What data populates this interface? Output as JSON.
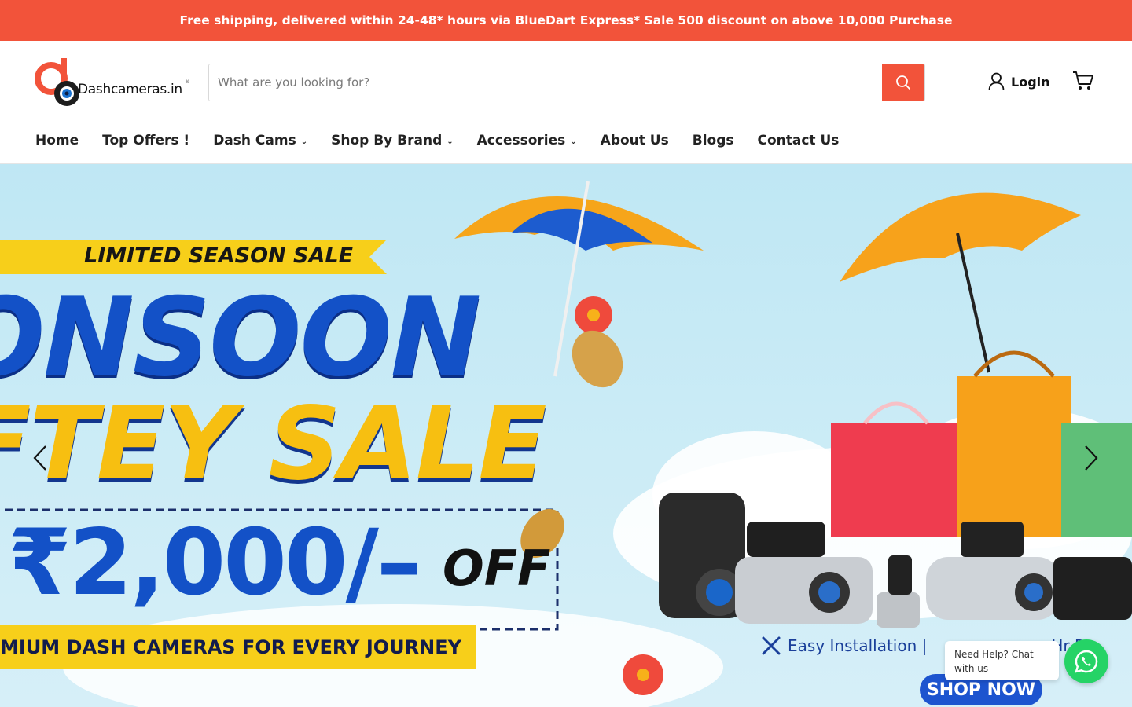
{
  "announcement": "Free shipping, delivered within 24-48* hours via BlueDart Express* Sale 500 discount on above 10,000 Purchase",
  "brand": {
    "logo_text": "Dashcameras.in",
    "registered": "®"
  },
  "search": {
    "placeholder": "What are you looking for?",
    "value": ""
  },
  "header": {
    "login_label": "Login"
  },
  "nav": {
    "items": [
      {
        "label": "Home"
      },
      {
        "label": "Top Offers !"
      },
      {
        "label": "Dash Cams"
      },
      {
        "label": "Shop By Brand"
      },
      {
        "label": "Accessories"
      },
      {
        "label": "About Us"
      },
      {
        "label": "Blogs"
      },
      {
        "label": "Contact Us"
      }
    ]
  },
  "hero": {
    "badge": "LIMITED SEASON SALE",
    "headline_1": "ONSOON",
    "headline_2": "FTEY SALE",
    "amount": "₹2,000/–",
    "off": "OFF",
    "tagline": "MIUM DASH CAMERAS FOR EVERY JOURNEY",
    "feature_1": "Easy Installation |",
    "feature_2": "Hr P",
    "cta": "SHOP NOW"
  },
  "chat": {
    "bubble_text": "Need Help? Chat with us"
  },
  "colors": {
    "accent": "#f2533a",
    "hero_blue": "#1351c7",
    "hero_yellow": "#f7bf11",
    "whatsapp": "#25d366"
  },
  "icons": [
    "search-icon",
    "user-icon",
    "cart-icon",
    "chevron-left-icon",
    "chevron-right-icon",
    "whatsapp-icon"
  ]
}
